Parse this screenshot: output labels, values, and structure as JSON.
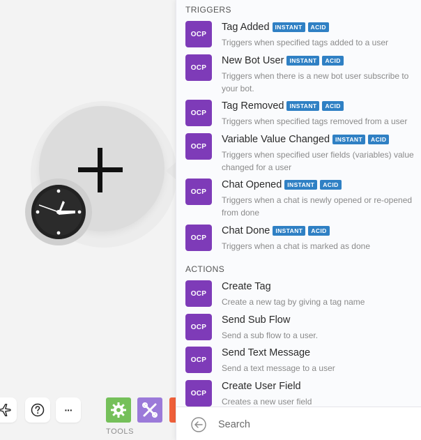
{
  "panel": {
    "sections": {
      "triggers": "TRIGGERS",
      "actions": "ACTIONS"
    },
    "badges": {
      "instant": "INSTANT",
      "acid": "ACID"
    },
    "app_icon_label": "OCP",
    "triggers": [
      {
        "title": "Tag Added",
        "desc": "Triggers when specified tags added to a user"
      },
      {
        "title": "New Bot User",
        "desc": "Triggers when there is a new bot user subscribe to your bot."
      },
      {
        "title": "Tag Removed",
        "desc": "Triggers when specified tags removed from a user"
      },
      {
        "title": "Variable Value Changed",
        "desc": "Triggers when specified user fields (variables) value changed for a user"
      },
      {
        "title": "Chat Opened",
        "desc": "Triggers when a chat is newly opened or re-opened from done"
      },
      {
        "title": "Chat Done",
        "desc": "Triggers when a chat is marked as done"
      }
    ],
    "actions": [
      {
        "title": "Create Tag",
        "desc": "Create a new tag by giving a tag name"
      },
      {
        "title": "Send Sub Flow",
        "desc": "Send a sub flow to a user."
      },
      {
        "title": "Send Text Message",
        "desc": "Send a text message to a user"
      },
      {
        "title": "Create User Field",
        "desc": "Creates a new user field"
      }
    ],
    "search": {
      "placeholder": "Search"
    }
  },
  "toolbar": {
    "tools_label": "TOOLS",
    "more_label": "···",
    "icons": [
      "airplane-icon",
      "help-icon",
      "more-icon",
      "gear-icon",
      "tools-icon"
    ]
  },
  "colors": {
    "app_icon": "#7e3bb8",
    "badge": "#2f80c4",
    "gear_tile": "#75c05a",
    "tools_tile": "#9b7ad9",
    "orange_tile": "#f0603a"
  }
}
